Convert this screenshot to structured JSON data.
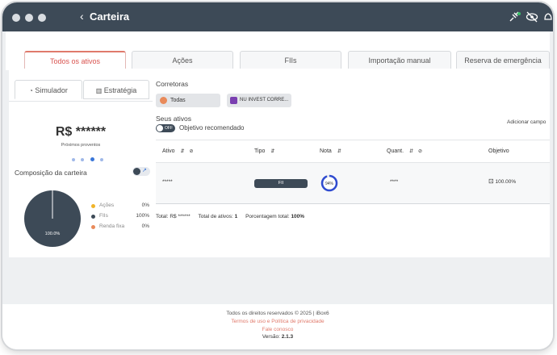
{
  "window": {
    "title": "Carteira"
  },
  "tabs": [
    "Todos os ativos",
    "Ações",
    "FIIs",
    "Importação manual",
    "Reserva de emergência"
  ],
  "left": {
    "subtabs": [
      "Simulador",
      "Estratégia"
    ],
    "balance": "R$ ******",
    "next_label": "Próximos proventos",
    "composition_title": "Composição da carteira",
    "pie_center_label": "100.0%",
    "legend": [
      {
        "label": "Ações",
        "value": "0%",
        "color": "#f0b429"
      },
      {
        "label": "FIIs",
        "value": "100%",
        "color": "#3d4a57"
      },
      {
        "label": "Renda fixa",
        "value": "0%",
        "color": "#e98a5a"
      }
    ]
  },
  "right": {
    "brokers_title": "Corretoras",
    "broker_all": "Todas",
    "broker_nu": "NU INVEST CORRE...",
    "assets_title": "Seus ativos",
    "toggle_label": "OFF",
    "objective_label": "Objetivo recomendado",
    "add_field": "Adicionar campo",
    "columns": [
      "Ativo",
      "Tipo",
      "Nota",
      "Quant.",
      "Objetivo"
    ],
    "row": {
      "ativo": "*****",
      "tipo": "FII",
      "nota": "94%",
      "quant": "****",
      "objetivo": "100.00%"
    },
    "total_label": "Total: R$ ******",
    "total_assets_label": "Total de ativos:",
    "total_assets_value": "1",
    "pct_label": "Porcentagem total:",
    "pct_value": "100%"
  },
  "footer": {
    "rights": "Todos os direitos reservados © 2025 | iBox6",
    "terms": "Termos de uso e Política de privacidade",
    "contact": "Fale conosco",
    "version_label": "Versão:",
    "version_value": "2.1.3"
  }
}
